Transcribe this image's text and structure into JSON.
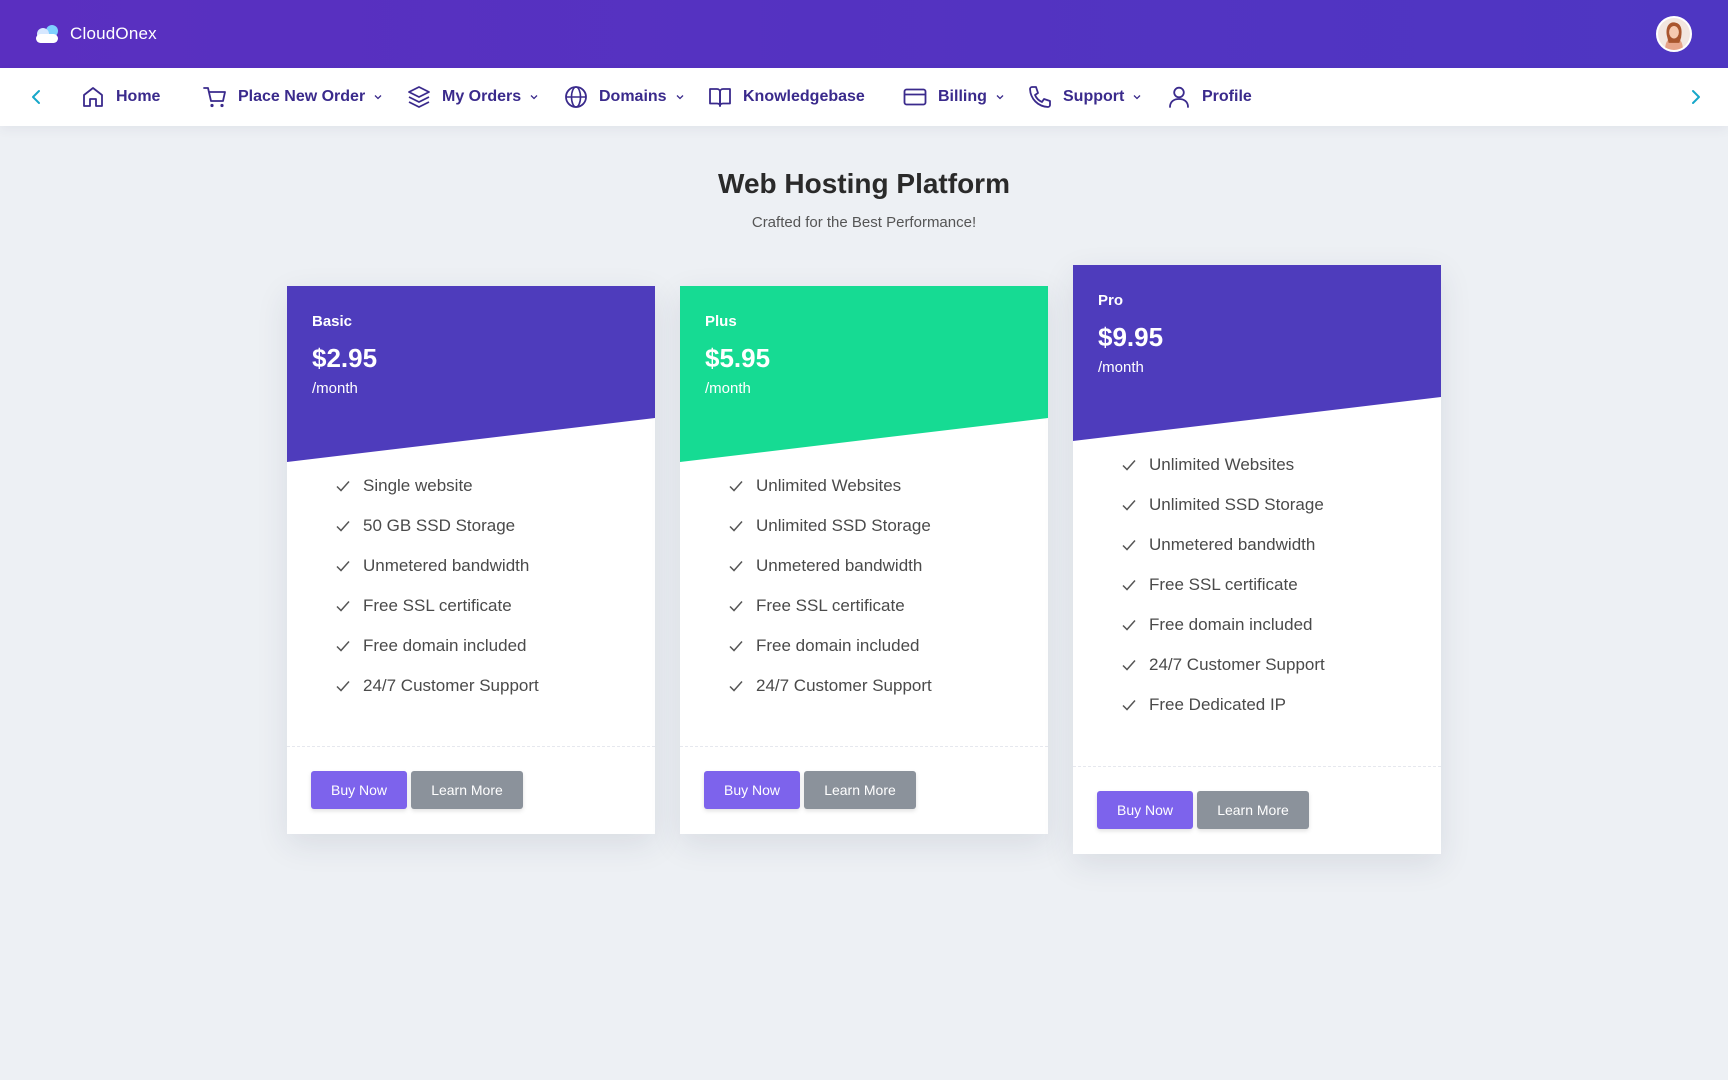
{
  "brand": {
    "name": "CloudOnex",
    "icon": "cloud-icon"
  },
  "nav": {
    "items": [
      {
        "label": "Home",
        "icon": "home-icon",
        "dropdown": false
      },
      {
        "label": "Place New Order",
        "icon": "cart-icon",
        "dropdown": true
      },
      {
        "label": "My Orders",
        "icon": "layers-icon",
        "dropdown": true
      },
      {
        "label": "Domains",
        "icon": "globe-icon",
        "dropdown": true
      },
      {
        "label": "Knowledgebase",
        "icon": "book-icon",
        "dropdown": false
      },
      {
        "label": "Billing",
        "icon": "credit-card-icon",
        "dropdown": true
      },
      {
        "label": "Support",
        "icon": "phone-icon",
        "dropdown": true
      },
      {
        "label": "Profile",
        "icon": "user-icon",
        "dropdown": false
      }
    ]
  },
  "header": {
    "title": "Web Hosting Platform",
    "subtitle": "Crafted for the Best Performance!"
  },
  "plans": [
    {
      "name": "Basic",
      "price": "$2.95",
      "period": "/month",
      "color": "#4e3cbc",
      "features": [
        "Single website",
        "50 GB SSD Storage",
        "Unmetered bandwidth",
        "Free SSL certificate",
        "Free domain included",
        "24/7 Customer Support"
      ],
      "buy_label": "Buy Now",
      "learn_label": "Learn More"
    },
    {
      "name": "Plus",
      "price": "$5.95",
      "period": "/month",
      "color": "#16db93",
      "features": [
        "Unlimited Websites",
        "Unlimited SSD Storage",
        "Unmetered bandwidth",
        "Free SSL certificate",
        "Free domain included",
        "24/7 Customer Support"
      ],
      "buy_label": "Buy Now",
      "learn_label": "Learn More"
    },
    {
      "name": "Pro",
      "price": "$9.95",
      "period": "/month",
      "color": "#4e3cbc",
      "features": [
        "Unlimited Websites",
        "Unlimited SSD Storage",
        "Unmetered bandwidth",
        "Free SSL certificate",
        "Free domain included",
        "24/7 Customer Support",
        "Free Dedicated IP"
      ],
      "buy_label": "Buy Now",
      "learn_label": "Learn More"
    }
  ],
  "colors": {
    "topbar": "#5a2fc0",
    "nav_text": "#3a2a8c",
    "nav_arrow": "#16a7c9",
    "buy_button": "#7d63ec",
    "learn_button": "#8b929b",
    "background": "#edf0f4"
  }
}
